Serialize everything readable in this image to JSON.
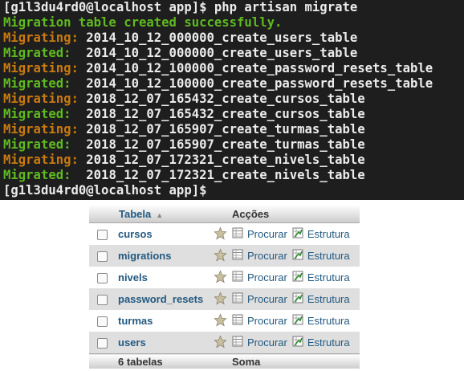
{
  "terminal": {
    "lines": [
      [
        {
          "text": "[g1l3du4rd0@localhost app]$ php artisan migrate",
          "color": "white"
        }
      ],
      [
        {
          "text": "Migration table created successfully.",
          "color": "green"
        }
      ],
      [
        {
          "text": "Migrating: ",
          "color": "orange"
        },
        {
          "text": "2014_10_12_000000_create_users_table",
          "color": "white"
        }
      ],
      [
        {
          "text": "Migrated:  ",
          "color": "green"
        },
        {
          "text": "2014_10_12_000000_create_users_table",
          "color": "white"
        }
      ],
      [
        {
          "text": "Migrating: ",
          "color": "orange"
        },
        {
          "text": "2014_10_12_100000_create_password_resets_table",
          "color": "white"
        }
      ],
      [
        {
          "text": "Migrated:  ",
          "color": "green"
        },
        {
          "text": "2014_10_12_100000_create_password_resets_table",
          "color": "white"
        }
      ],
      [
        {
          "text": "Migrating: ",
          "color": "orange"
        },
        {
          "text": "2018_12_07_165432_create_cursos_table",
          "color": "white"
        }
      ],
      [
        {
          "text": "Migrated:  ",
          "color": "green"
        },
        {
          "text": "2018_12_07_165432_create_cursos_table",
          "color": "white"
        }
      ],
      [
        {
          "text": "Migrating: ",
          "color": "orange"
        },
        {
          "text": "2018_12_07_165907_create_turmas_table",
          "color": "white"
        }
      ],
      [
        {
          "text": "Migrated:  ",
          "color": "green"
        },
        {
          "text": "2018_12_07_165907_create_turmas_table",
          "color": "white"
        }
      ],
      [
        {
          "text": "Migrating: ",
          "color": "orange"
        },
        {
          "text": "2018_12_07_172321_create_nivels_table",
          "color": "white"
        }
      ],
      [
        {
          "text": "Migrated:  ",
          "color": "green"
        },
        {
          "text": "2018_12_07_172321_create_nivels_table",
          "color": "white"
        }
      ],
      [
        {
          "text": "[g1l3du4rd0@localhost app]$",
          "color": "white"
        }
      ]
    ],
    "colors": {
      "background": "#1e1e1e",
      "green": "#5fba1f",
      "orange": "#c87a10",
      "white": "#ececec"
    }
  },
  "table": {
    "header": {
      "name": "Tabela",
      "actions": "Acções"
    },
    "rows": [
      {
        "name": "cursos"
      },
      {
        "name": "migrations"
      },
      {
        "name": "nivels"
      },
      {
        "name": "password_resets"
      },
      {
        "name": "turmas"
      },
      {
        "name": "users"
      }
    ],
    "browse_label": "Procurar",
    "structure_label": "Estrutura",
    "footer": {
      "count": "6 tabelas",
      "sum": "Soma"
    }
  }
}
